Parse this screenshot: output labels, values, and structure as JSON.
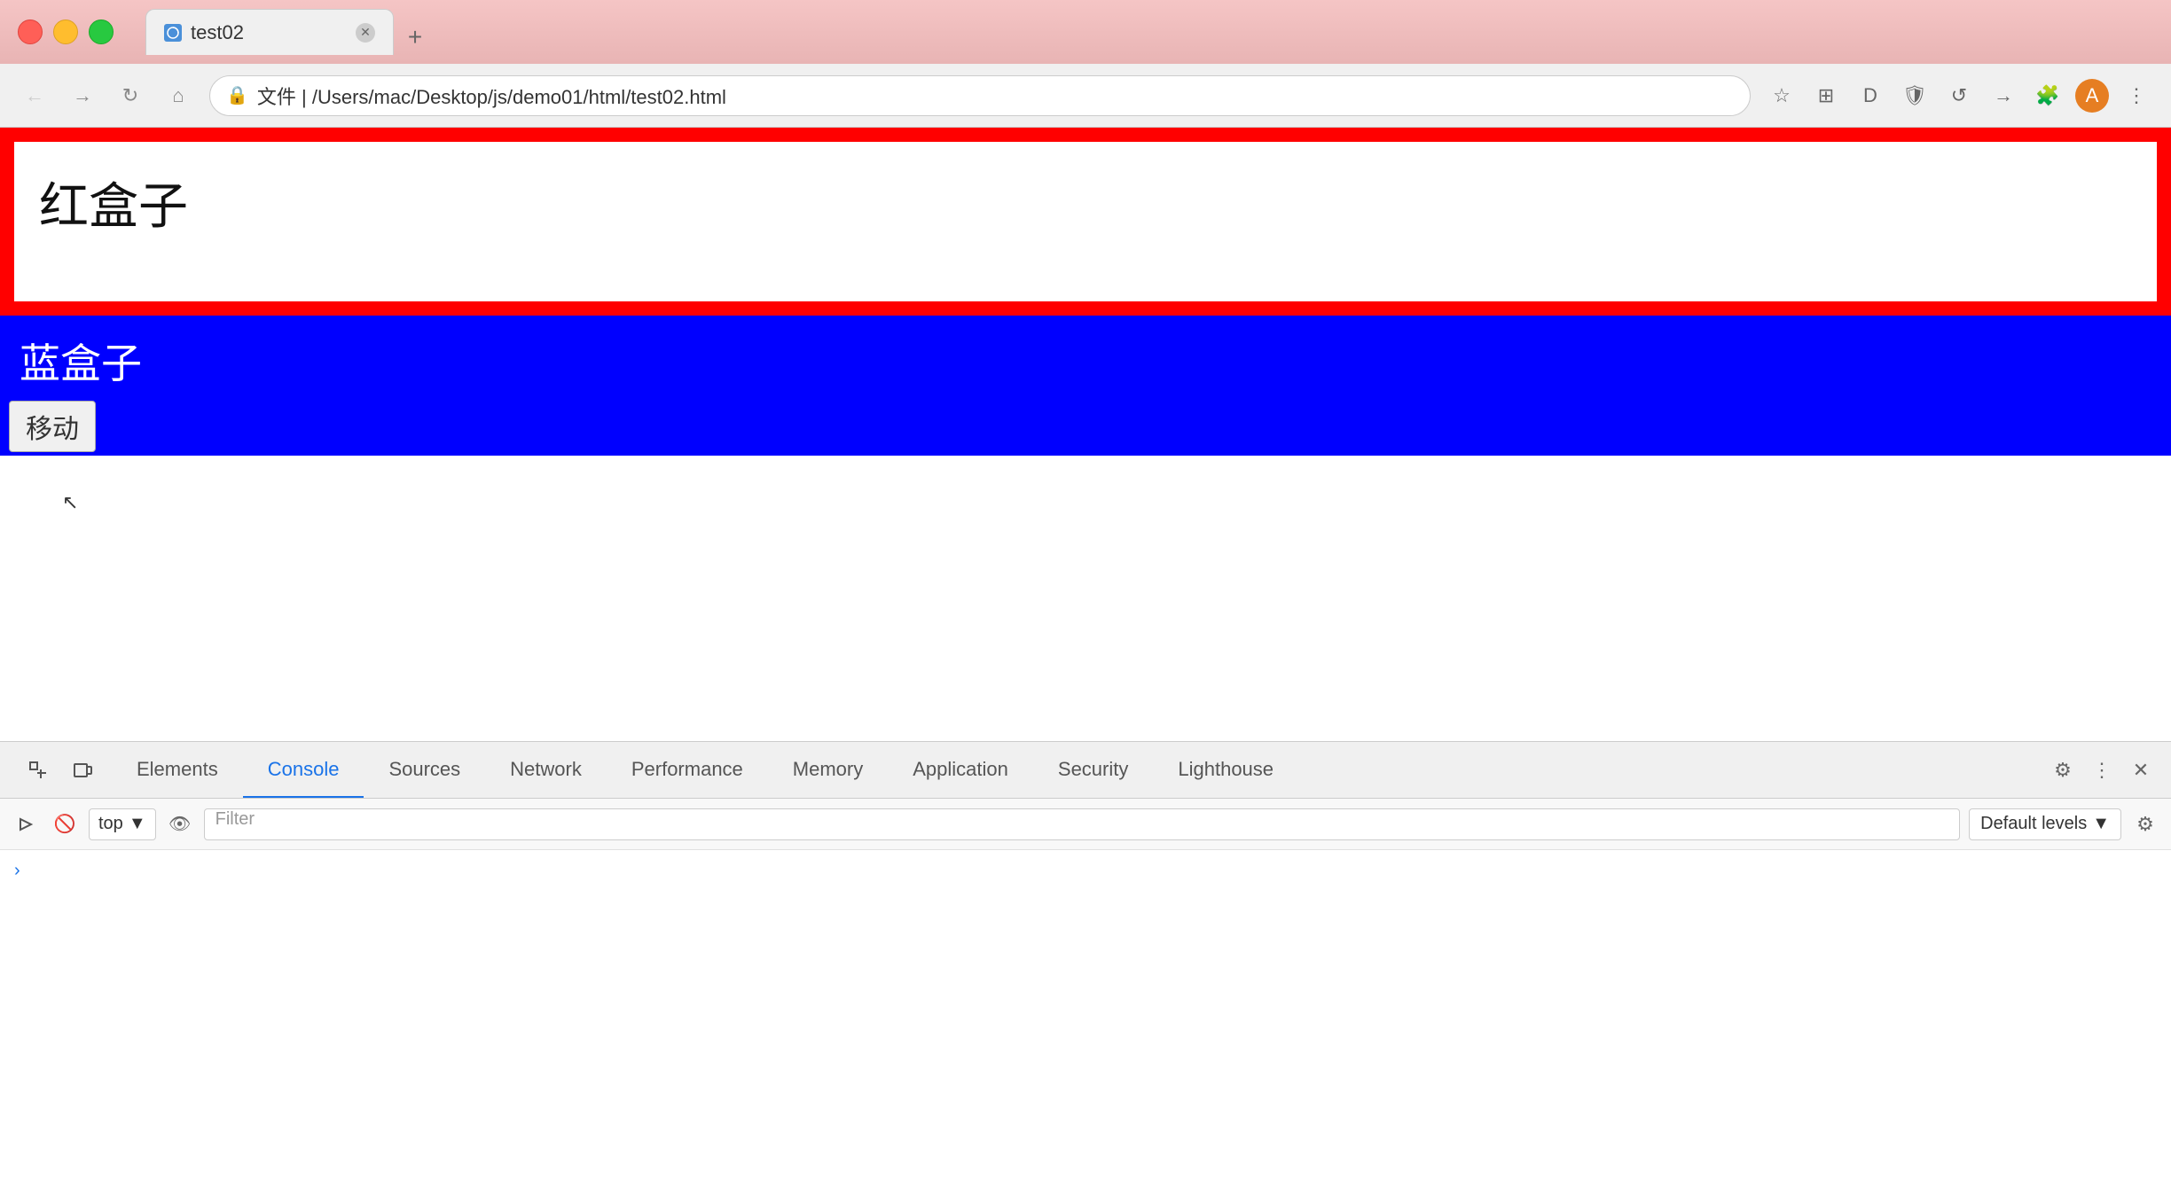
{
  "browser": {
    "tab_title": "test02",
    "tab_favicon": "🌐",
    "address": "文件  |  /Users/mac/Desktop/js/demo01/html/test02.html"
  },
  "page": {
    "red_box_label": "红盒子",
    "blue_box_label": "蓝盒子",
    "move_btn_label": "移动"
  },
  "devtools": {
    "tabs": [
      {
        "label": "Elements",
        "active": false
      },
      {
        "label": "Console",
        "active": true
      },
      {
        "label": "Sources",
        "active": false
      },
      {
        "label": "Network",
        "active": false
      },
      {
        "label": "Performance",
        "active": false
      },
      {
        "label": "Memory",
        "active": false
      },
      {
        "label": "Application",
        "active": false
      },
      {
        "label": "Security",
        "active": false
      },
      {
        "label": "Lighthouse",
        "active": false
      }
    ],
    "console": {
      "context": "top",
      "filter_placeholder": "Filter",
      "levels": "Default levels"
    }
  }
}
